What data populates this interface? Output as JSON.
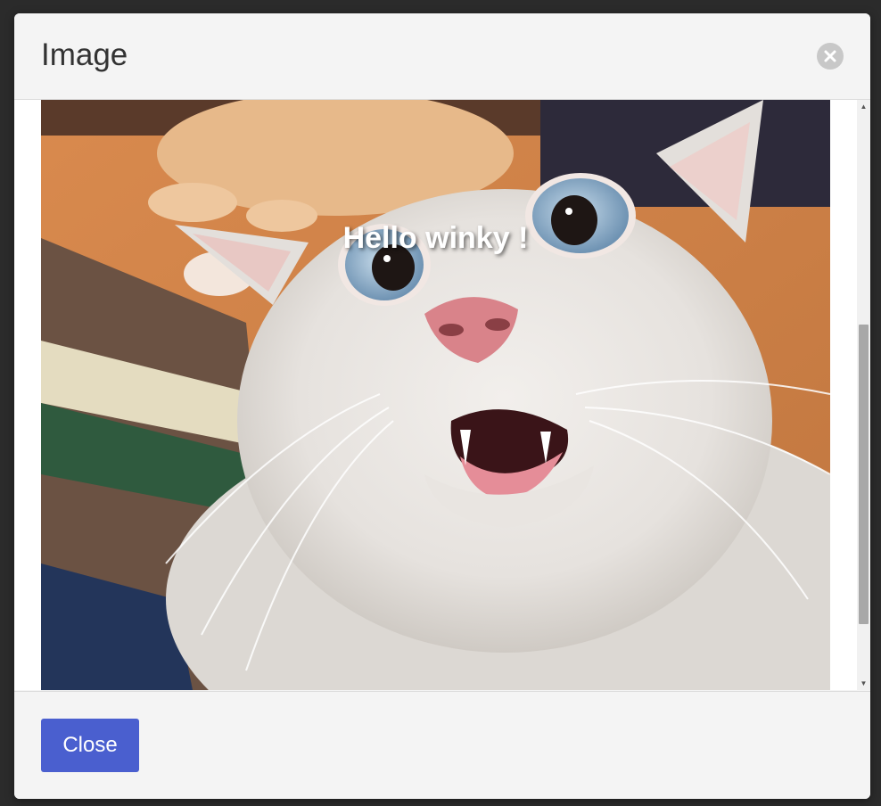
{
  "modal": {
    "title": "Image",
    "close_icon": "close-circle-icon",
    "caption": "Hello winky !",
    "footer": {
      "close_label": "Close"
    }
  },
  "colors": {
    "overlay": "#2b2b2b",
    "modal_bg": "#f4f4f4",
    "primary_button": "#4a5fcf",
    "close_icon_bg": "#c8c8c8"
  },
  "scrollbar": {
    "up_icon": "arrow-up-icon",
    "down_icon": "arrow-down-icon"
  }
}
